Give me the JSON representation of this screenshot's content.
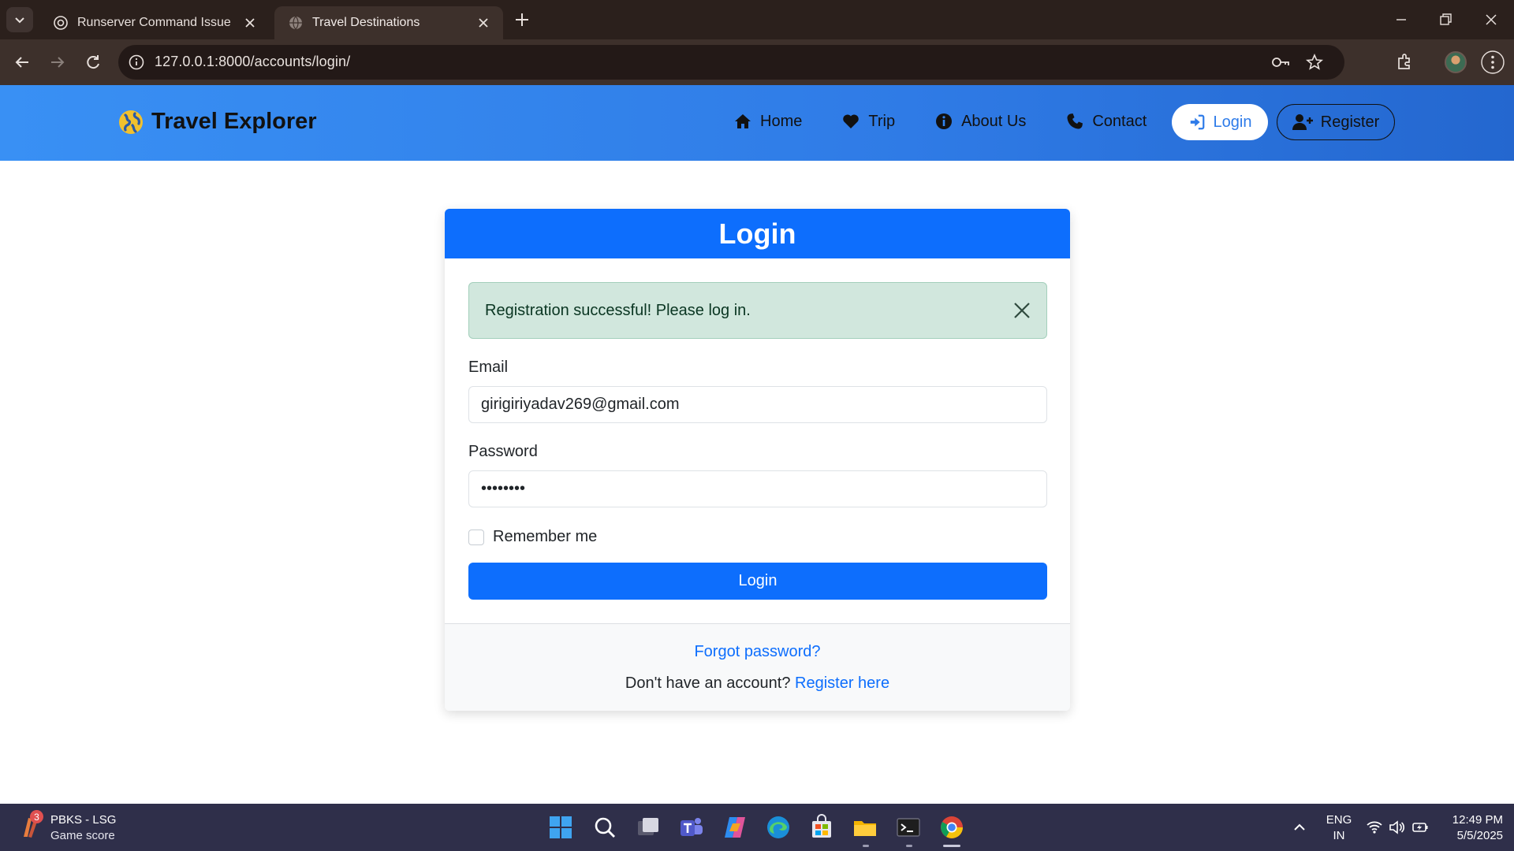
{
  "browser": {
    "tabs": [
      {
        "label": "Runserver Command Issue",
        "active": false
      },
      {
        "label": "Travel Destinations",
        "active": true
      }
    ],
    "url": "127.0.0.1:8000/accounts/login/"
  },
  "site": {
    "brand": "Travel Explorer",
    "nav": [
      {
        "label": "Home",
        "icon": "home-icon"
      },
      {
        "label": "Trip",
        "icon": "heart-icon"
      },
      {
        "label": "About Us",
        "icon": "info-icon"
      },
      {
        "label": "Contact",
        "icon": "phone-icon"
      }
    ],
    "login_button": "Login",
    "register_button": "Register"
  },
  "login": {
    "title": "Login",
    "alert": "Registration successful! Please log in.",
    "email_label": "Email",
    "email_value": "girigiriyadav269@gmail.com",
    "password_label": "Password",
    "password_value": "••••••••",
    "remember_label": "Remember me",
    "submit_label": "Login",
    "forgot_link": "Forgot password?",
    "no_account_text": "Don't have an account?",
    "register_link": "Register here"
  },
  "taskbar": {
    "widget_badge": "3",
    "widget_title": "PBKS - LSG",
    "widget_subtitle": "Game score",
    "lang_line1": "ENG",
    "lang_line2": "IN",
    "time": "12:49 PM",
    "date": "5/5/2025"
  },
  "colors": {
    "primary": "#0d6efd",
    "nav_gradient_start": "#3990f4",
    "alert_bg": "#d1e7dd",
    "chrome_bg": "#2b201c",
    "taskbar_bg": "#2f2f4a"
  }
}
